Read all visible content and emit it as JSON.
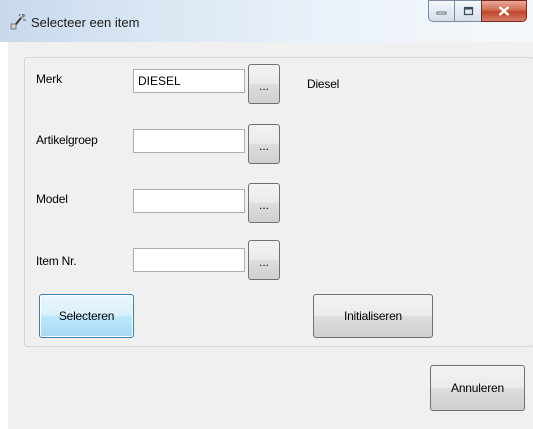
{
  "window": {
    "title": "Selecteer een item",
    "icon": "app-wand-icon",
    "controls": {
      "minimize": "minimize-icon",
      "maximize": "maximize-icon",
      "close": "close-icon"
    }
  },
  "form": {
    "merk": {
      "label": "Merk",
      "value": "DIESEL",
      "browse_label": "...",
      "description": "Diesel"
    },
    "artikelgroep": {
      "label": "Artikelgroep",
      "value": "",
      "browse_label": "..."
    },
    "model": {
      "label": "Model",
      "value": "",
      "browse_label": "..."
    },
    "item_nr": {
      "label": "Item Nr.",
      "value": "",
      "browse_label": "..."
    }
  },
  "buttons": {
    "select": "Selecteren",
    "reset": "Initialiseren",
    "cancel": "Annuleren"
  },
  "colors": {
    "close_button": "#c0462a",
    "focus_border": "#3c7fb1",
    "client_background": "#f0f0f0"
  }
}
